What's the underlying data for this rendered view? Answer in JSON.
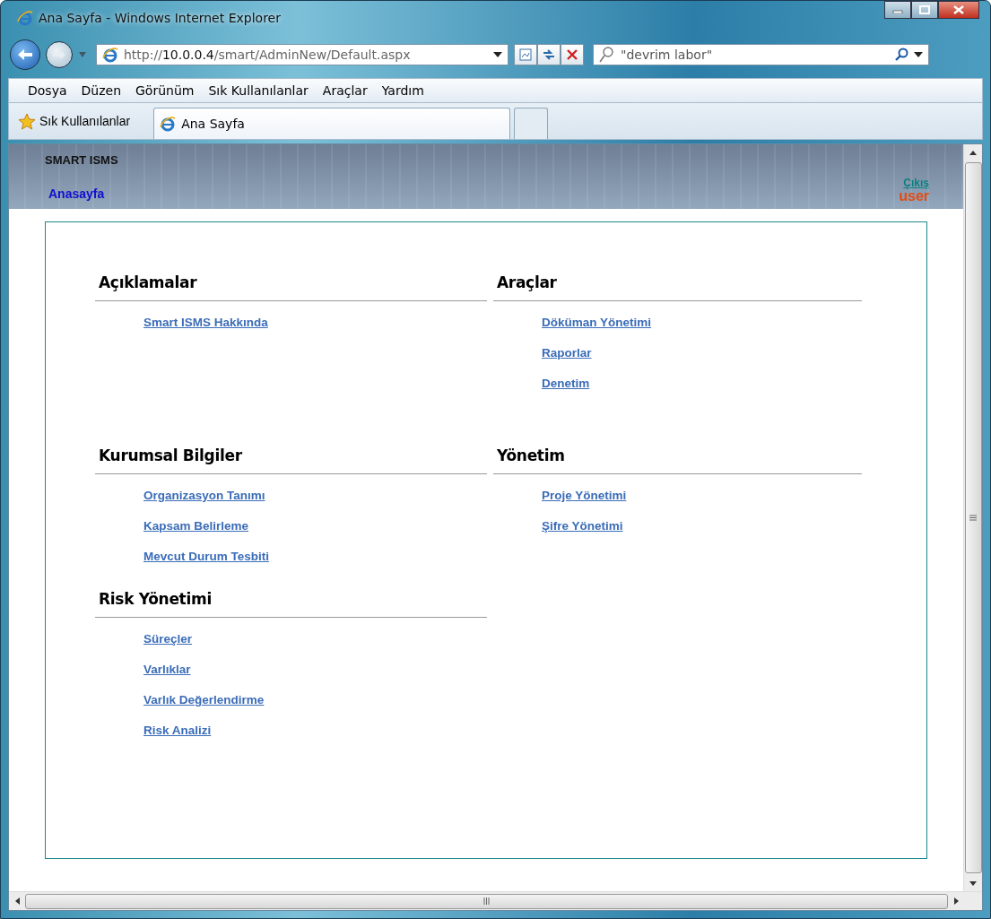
{
  "window": {
    "title": "Ana Sayfa - Windows Internet Explorer"
  },
  "address": {
    "url_prefix": "http://",
    "url_host": "10.0.0.4",
    "url_path": "/smart/AdminNew/Default.aspx"
  },
  "search": {
    "value": "\"devrim labor\""
  },
  "menu": [
    "Dosya",
    "Düzen",
    "Görünüm",
    "Sık Kullanılanlar",
    "Araçlar",
    "Yardım"
  ],
  "favorites": {
    "label": "Sık Kullanılanlar"
  },
  "tabs": [
    {
      "label": "Ana Sayfa",
      "selected": true
    }
  ],
  "page": {
    "site_title": "SMART ISMS",
    "home_link": "Anasayfa",
    "logout_link": "Çıkış",
    "user": "user"
  },
  "columns": [
    {
      "sections": [
        {
          "title": "Açıklamalar",
          "links": [
            "Smart ISMS Hakkında"
          ]
        },
        {
          "title": "Kurumsal Bilgiler",
          "links": [
            "Organizasyon Tanımı",
            "Kapsam Belirleme",
            "Mevcut Durum Tesbiti"
          ]
        },
        {
          "title": "Risk Yönetimi",
          "links": [
            "Süreçler",
            "Varlıklar",
            "Varlık Değerlendirme",
            "Risk Analizi"
          ]
        }
      ]
    },
    {
      "sections": [
        {
          "title": "Araçlar",
          "links": [
            "Döküman Yönetimi",
            "Raporlar",
            "Denetim"
          ]
        },
        {
          "title": "Yönetim",
          "links": [
            "Proje Yönetimi",
            "Şifre Yönetimi"
          ]
        }
      ]
    }
  ]
}
